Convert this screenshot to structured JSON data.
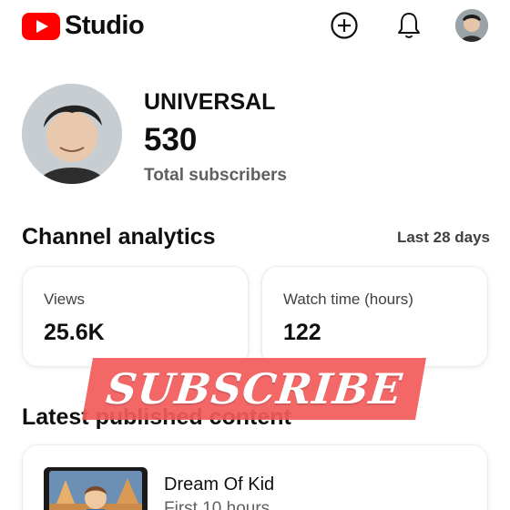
{
  "header": {
    "logo_text": "Studio",
    "icons": {
      "create": "add-circle-icon",
      "notifications": "bell-icon",
      "account": "avatar"
    }
  },
  "channel": {
    "name": "UNIVERSAL",
    "subscriber_count": "530",
    "subscriber_label": "Total subscribers"
  },
  "analytics": {
    "title": "Channel analytics",
    "period": "Last 28 days",
    "cards": [
      {
        "label": "Views",
        "value": "25.6K"
      },
      {
        "label": "Watch time (hours)",
        "value": "122"
      }
    ]
  },
  "latest": {
    "title": "Latest published content",
    "items": [
      {
        "title": "Dream Of Kid",
        "subtitle": "First 10 hours"
      }
    ]
  },
  "overlay": {
    "text": "SUBSCRIBE"
  },
  "colors": {
    "brand_red": "#ff0000",
    "banner": "#f45b5b",
    "secondary_text": "#606060"
  }
}
